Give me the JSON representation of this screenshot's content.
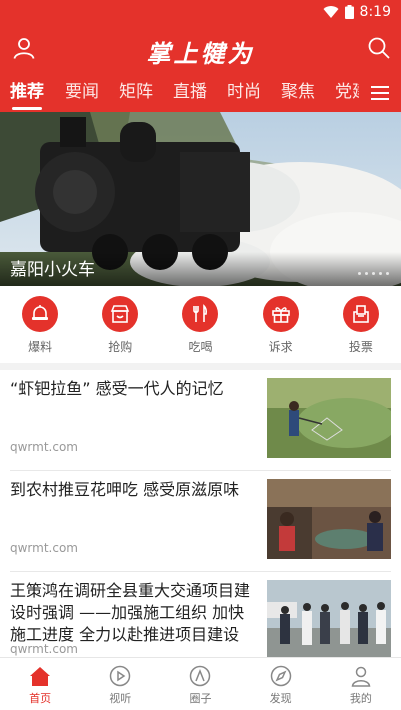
{
  "status": {
    "time": "8:19"
  },
  "header": {
    "title": "掌上犍为"
  },
  "channels": [
    "推荐",
    "要闻",
    "矩阵",
    "直播",
    "时尚",
    "聚焦",
    "党建"
  ],
  "banner": {
    "caption": "嘉阳小火车"
  },
  "quick_links": [
    {
      "label": "爆料",
      "icon": "megaphone-icon"
    },
    {
      "label": "抢购",
      "icon": "shop-icon"
    },
    {
      "label": "吃喝",
      "icon": "utensils-icon"
    },
    {
      "label": "诉求",
      "icon": "gift-icon"
    },
    {
      "label": "投票",
      "icon": "ballot-box-icon"
    }
  ],
  "news": [
    {
      "title": "“虾钯拉鱼” 感受一代人的记忆",
      "source": "qwrmt.com"
    },
    {
      "title": "到农村推豆花呷吃  感受原滋原味",
      "source": "qwrmt.com"
    },
    {
      "title": "王策鸿在调研全县重大交通项目建设时强调  ——加强施工组织 加快施工进度 全力以赴推进项目建设",
      "source": "qwrmt.com"
    }
  ],
  "bottom_nav": [
    {
      "label": "首页",
      "icon": "home-icon"
    },
    {
      "label": "视听",
      "icon": "play-icon"
    },
    {
      "label": "圈子",
      "icon": "circle-icon"
    },
    {
      "label": "发现",
      "icon": "compass-icon"
    },
    {
      "label": "我的",
      "icon": "user-icon"
    }
  ],
  "colors": {
    "brand_red": "#e4322b",
    "text_dark": "#222222",
    "text_muted": "#999999"
  }
}
